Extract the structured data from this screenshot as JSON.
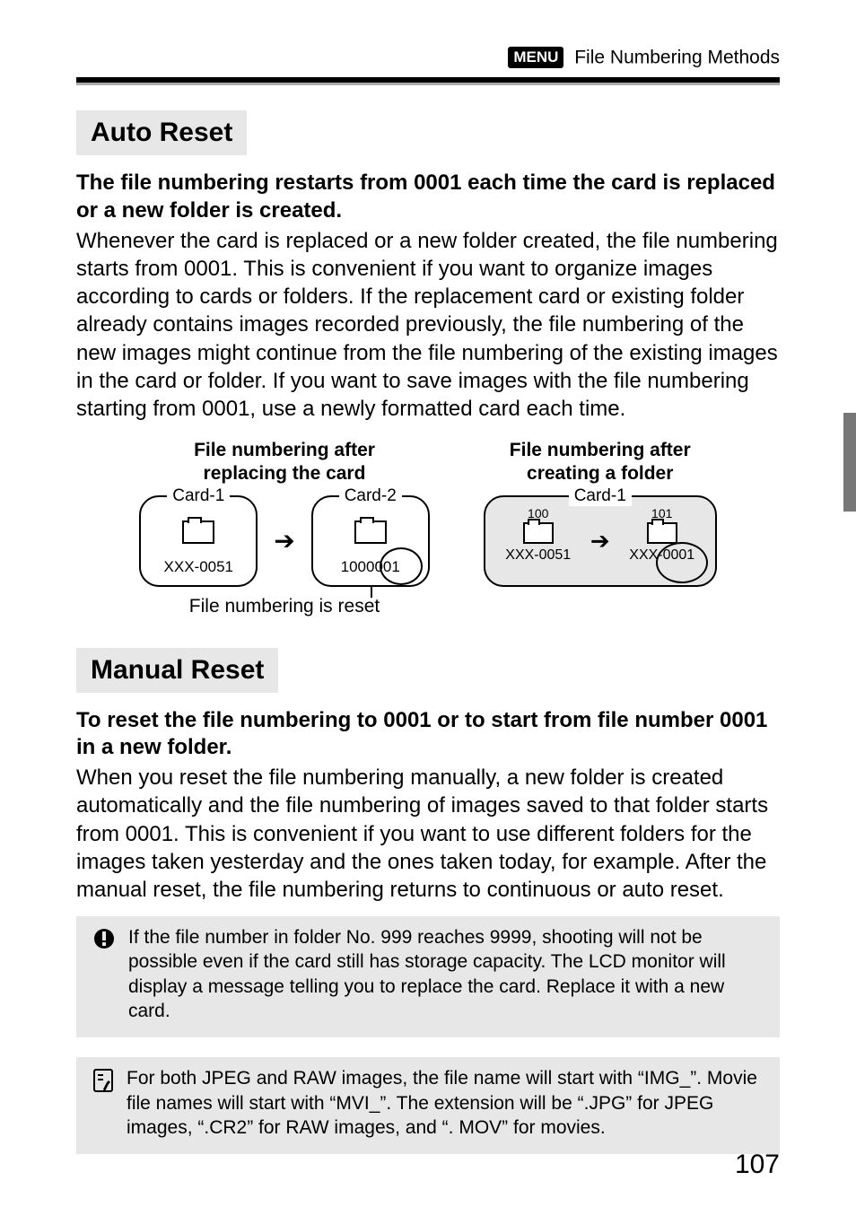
{
  "header": {
    "menu_label": "MENU",
    "chapter": "File Numbering Methods"
  },
  "section1": {
    "title": "Auto Reset",
    "lead": "The file numbering restarts from 0001 each time the card is replaced or a new folder is created.",
    "body": "Whenever the card is replaced or a new folder created, the file numbering starts from 0001. This is convenient if you want to organize images according to cards or folders. If the replacement card or existing folder already contains images recorded previously, the file numbering of the new images might continue from the file numbering of the existing images in the card or folder. If you want to save images with the file numbering starting from 0001, use a newly formatted card each time."
  },
  "diagram": {
    "left": {
      "title_l1": "File numbering after",
      "title_l2": "replacing the card",
      "card1": {
        "name": "Card-1",
        "value": "XXX-0051"
      },
      "card2": {
        "name": "Card-2",
        "folder_num": "100",
        "value": "0001"
      },
      "caption": "File numbering is reset"
    },
    "right": {
      "title_l1": "File numbering after",
      "title_l2": "creating a folder",
      "card": {
        "name": "Card-1",
        "folderA": {
          "num": "100",
          "value": "XXX-0051"
        },
        "folderB": {
          "num": "101",
          "value": "XXX-0001"
        }
      }
    }
  },
  "section2": {
    "title": "Manual Reset",
    "lead": "To reset the file numbering to 0001 or to start from file number 0001 in a new folder.",
    "body": "When you reset the file numbering manually, a new folder is created automatically and the file numbering of images saved to that folder starts from 0001. This is convenient if you want to use different folders for the images taken yesterday and the ones taken today, for example. After the manual reset, the file numbering returns to continuous or auto reset."
  },
  "notes": {
    "warn": "If the file number in folder No. 999 reaches 9999, shooting will not be possible even if the card still has storage capacity. The LCD monitor will display a message telling you to replace the card. Replace it with a new card.",
    "info": "For both JPEG and RAW images, the file name will start with “IMG_”. Movie file names will start with “MVI_”. The extension will be “.JPG” for JPEG images, “.CR2” for RAW images, and “. MOV” for movies."
  },
  "page_number": "107"
}
